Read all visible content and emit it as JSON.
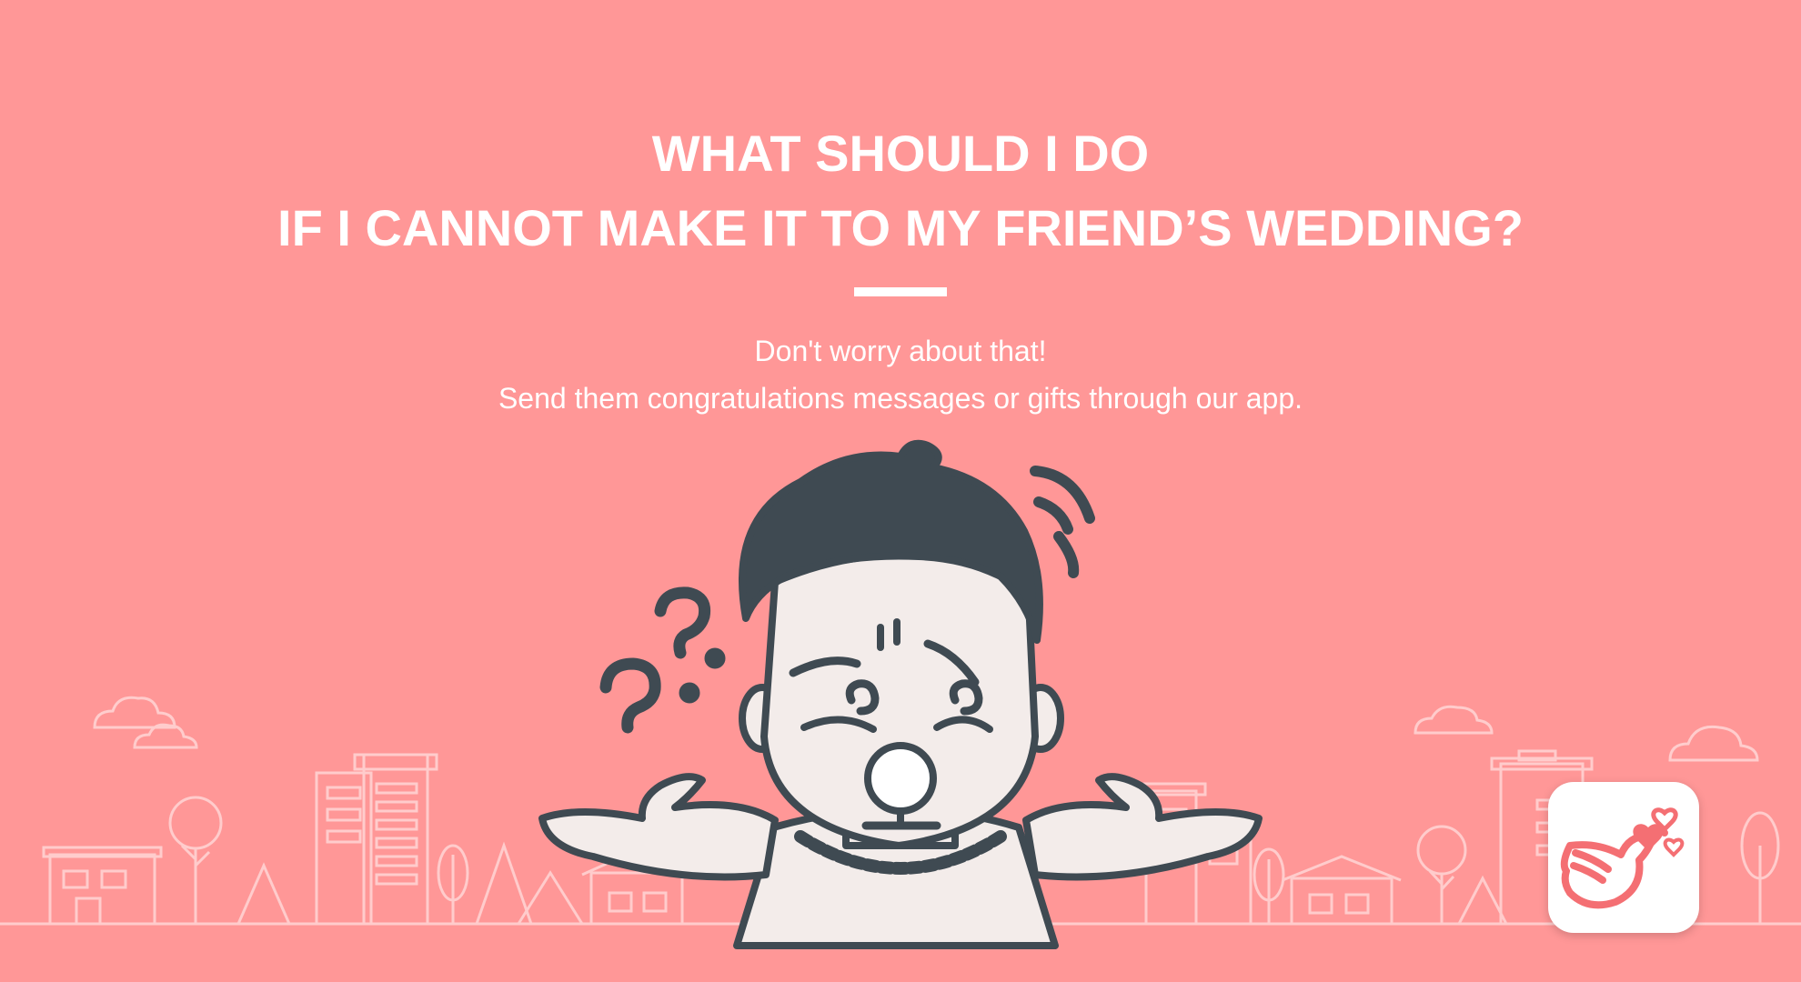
{
  "headline": {
    "line1": "WHAT SHOULD I DO",
    "line2": "IF I CANNOT MAKE IT TO MY FRIEND’S WEDDING?"
  },
  "body": {
    "line1": "Don't worry about that!",
    "line2": "Send them congratulations messages or gifts through our app."
  },
  "icons": {
    "character": "confused-person-illustration",
    "question_marks": "question-marks-icon",
    "city": "city-skyline-outline",
    "clouds": "cloud-icon",
    "app": "dove-with-hearts-app-icon"
  },
  "colors": {
    "background": "#ff9797",
    "text": "#ffffff",
    "hair": "#3f4a52",
    "skin": "#f3ecea",
    "accent": "#f46f73"
  }
}
